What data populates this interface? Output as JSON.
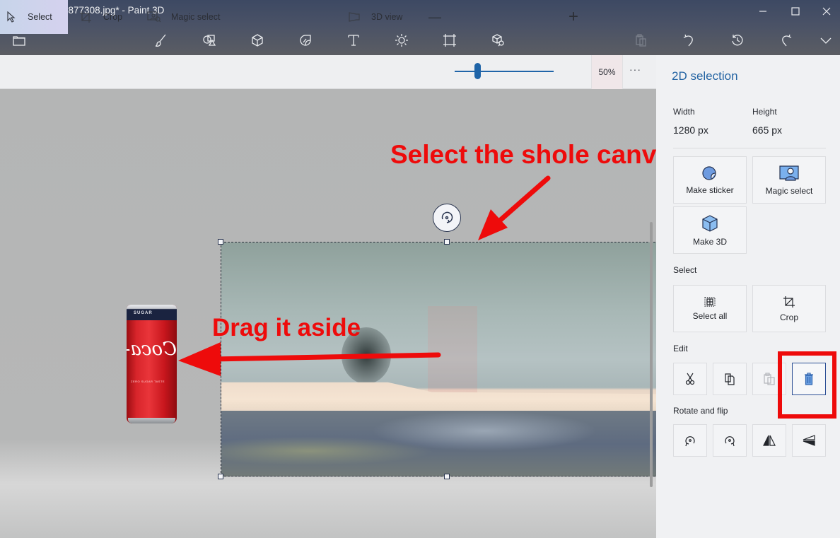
{
  "window": {
    "title": "pexels-himkan-877308.jpg* - Paint 3D",
    "controls": [
      "minimize",
      "maximize",
      "close"
    ]
  },
  "toolbar": {
    "left_icon": "open-folder-icon",
    "tools": [
      {
        "name": "brushes",
        "icon": "brush-icon"
      },
      {
        "name": "2d-shapes",
        "icon": "2d-shapes-icon"
      },
      {
        "name": "3d-shapes",
        "icon": "3d-cube-icon"
      },
      {
        "name": "stickers",
        "icon": "sticker-icon"
      },
      {
        "name": "text",
        "icon": "text-icon",
        "glyph": "T"
      },
      {
        "name": "effects",
        "icon": "sun-effects-icon"
      },
      {
        "name": "canvas",
        "icon": "canvas-crop-icon"
      },
      {
        "name": "3d-library",
        "icon": "3d-library-icon"
      }
    ],
    "right_tools": [
      {
        "name": "paste",
        "icon": "paste-icon",
        "enabled": false
      },
      {
        "name": "undo",
        "icon": "undo-icon",
        "enabled": true
      },
      {
        "name": "history",
        "icon": "history-icon",
        "enabled": true
      },
      {
        "name": "redo",
        "icon": "redo-icon",
        "enabled": true
      },
      {
        "name": "expand",
        "icon": "chevron-down-icon",
        "enabled": true
      }
    ]
  },
  "ribbon": {
    "select_label": "Select",
    "crop_label": "Crop",
    "magic_select_label": "Magic select",
    "view3d_label": "3D view",
    "zoom_minus": "—",
    "zoom_plus": "+",
    "zoom_value": "50%",
    "zoom_slider_fraction": 0.23,
    "more_label": "···"
  },
  "canvas": {
    "annotation_top": "Select the shole canvas",
    "annotation_middle": "Drag it aside",
    "can_top_text": "SUGAR",
    "can_logo": "Coca-Cola",
    "can_subtext": "ZERO SUGAR TASTE"
  },
  "panel": {
    "title": "2D selection",
    "width_label": "Width",
    "width_value": "1280 px",
    "height_label": "Height",
    "height_value": "665 px",
    "actions": {
      "make_sticker": "Make sticker",
      "magic_select": "Magic select",
      "make_3d": "Make 3D"
    },
    "select_section": "Select",
    "select_all": "Select all",
    "crop": "Crop",
    "edit_section": "Edit",
    "edit_buttons": [
      {
        "name": "cut",
        "icon": "scissors-icon",
        "enabled": true
      },
      {
        "name": "copy",
        "icon": "copy-icon",
        "enabled": true
      },
      {
        "name": "paste",
        "icon": "paste-icon",
        "enabled": false
      },
      {
        "name": "delete",
        "icon": "trash-icon",
        "enabled": true,
        "highlighted": true
      }
    ],
    "rotate_section": "Rotate and flip",
    "rotate_buttons": [
      {
        "name": "rotate-left",
        "icon": "rotate-left-icon"
      },
      {
        "name": "rotate-right",
        "icon": "rotate-right-icon"
      },
      {
        "name": "flip-horizontal",
        "icon": "flip-horizontal-icon"
      },
      {
        "name": "flip-vertical",
        "icon": "flip-vertical-icon"
      }
    ]
  },
  "colors": {
    "accent": "#2464a3",
    "annotation_red": "#ee0b0b",
    "slider": "#1f64a8"
  }
}
